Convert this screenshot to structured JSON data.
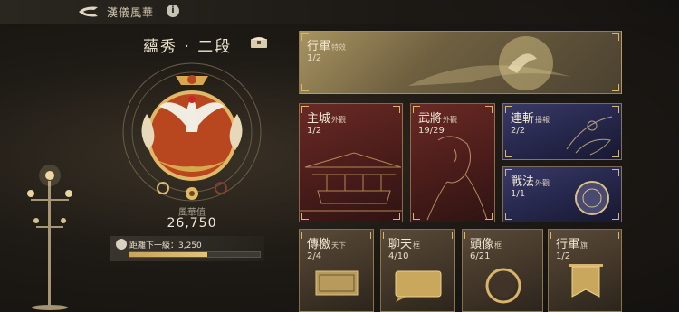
{
  "header": {
    "title": "漢儀風華",
    "info_glyph": "i"
  },
  "rank": {
    "title": "蘊秀 · 二段"
  },
  "value": {
    "label": "風華值",
    "number": "26,750"
  },
  "progress": {
    "label": "距離下一級：3,250",
    "fraction": 0.6
  },
  "cards": {
    "march_effect": {
      "title": "行軍",
      "sub": "特效",
      "count": "1/2"
    },
    "main_city": {
      "title": "主城",
      "sub": "外觀",
      "count": "1/2"
    },
    "general": {
      "title": "武將",
      "sub": "外觀",
      "count": "19/29"
    },
    "slash": {
      "title": "連斬",
      "sub": "播報",
      "count": "2/2"
    },
    "tactic": {
      "title": "戰法",
      "sub": "外觀",
      "count": "1/1"
    },
    "legend": {
      "title": "傳檄",
      "sub": "天下",
      "count": "2/4"
    },
    "chat": {
      "title": "聊天",
      "sub": "框",
      "count": "4/10"
    },
    "avatar": {
      "title": "頭像",
      "sub": "框",
      "count": "6/21"
    },
    "march_flag": {
      "title": "行軍",
      "sub": "旗",
      "count": "1/2"
    }
  }
}
